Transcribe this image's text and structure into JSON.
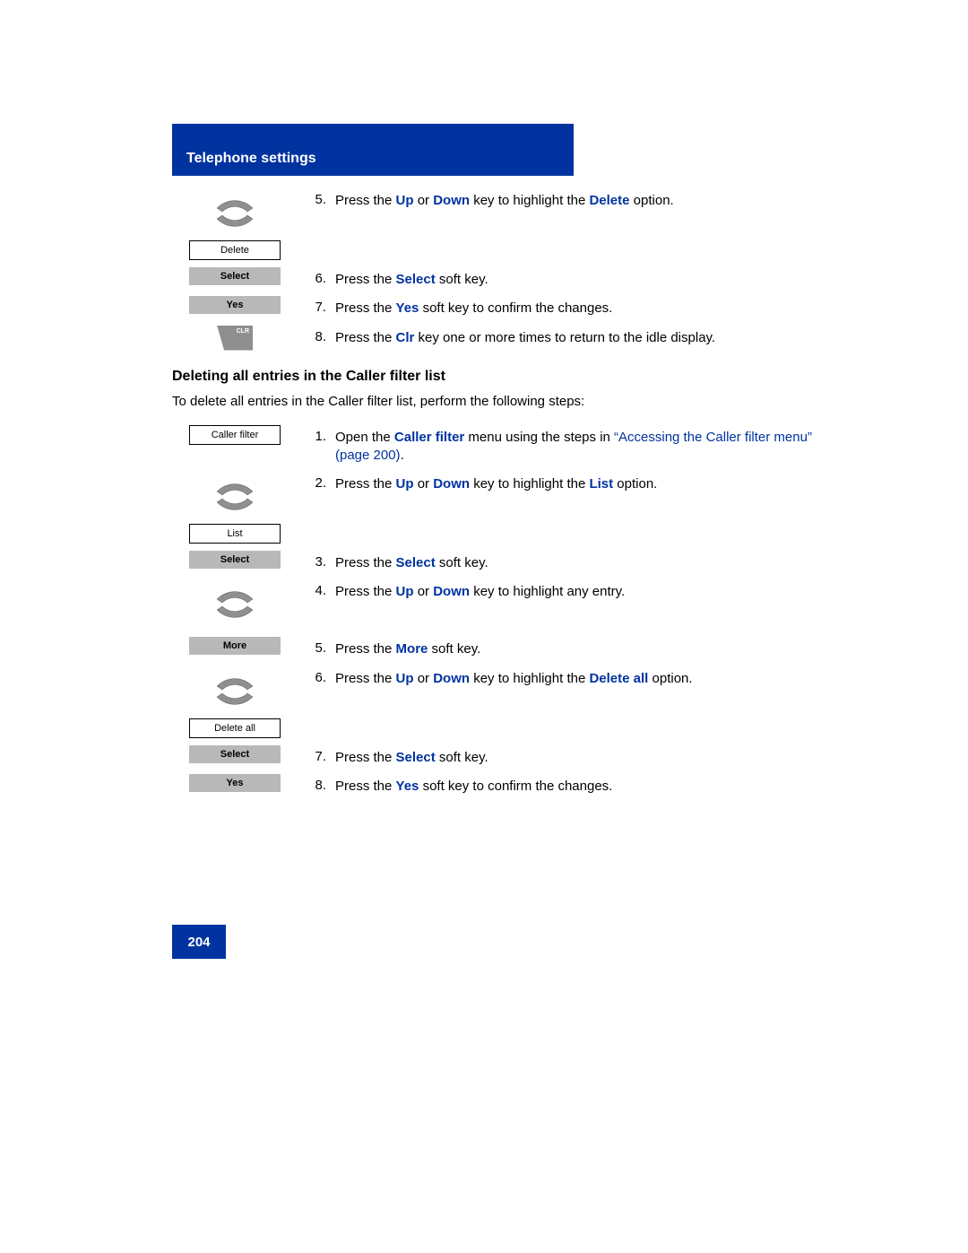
{
  "header": {
    "title": "Telephone settings"
  },
  "section1": {
    "steps": [
      {
        "no": "5.",
        "icon": "updown",
        "menu": "Delete",
        "parts": [
          {
            "t": "Press the "
          },
          {
            "t": "Up",
            "b": true
          },
          {
            "t": " or "
          },
          {
            "t": "Down",
            "b": true
          },
          {
            "t": " key to highlight the "
          },
          {
            "t": "Delete",
            "b": true
          },
          {
            "t": " option."
          }
        ]
      },
      {
        "no": "6.",
        "icon": "softkey",
        "soft": "Select",
        "parts": [
          {
            "t": "Press the "
          },
          {
            "t": "Select",
            "b": true
          },
          {
            "t": " soft key."
          }
        ]
      },
      {
        "no": "7.",
        "icon": "softkey",
        "soft": "Yes",
        "parts": [
          {
            "t": "Press the "
          },
          {
            "t": "Yes",
            "b": true
          },
          {
            "t": " soft key to confirm the changes."
          }
        ]
      },
      {
        "no": "8.",
        "icon": "clr",
        "parts": [
          {
            "t": "Press the "
          },
          {
            "t": "Clr",
            "b": true
          },
          {
            "t": " key one or more times to return to the idle display."
          }
        ]
      }
    ]
  },
  "section2": {
    "heading": "Deleting all entries in the Caller filter list",
    "intro": "To delete all entries in the Caller filter list, perform the following steps:",
    "steps": [
      {
        "no": "1.",
        "icon": "menu",
        "menu": "Caller filter",
        "parts": [
          {
            "t": "Open the "
          },
          {
            "t": "Caller filter",
            "b": true
          },
          {
            "t": " menu using the steps in "
          },
          {
            "t": "“Accessing the Caller filter menu” (page 200)",
            "link": true
          },
          {
            "t": "."
          }
        ]
      },
      {
        "no": "2.",
        "icon": "updown",
        "menu": "List",
        "parts": [
          {
            "t": "Press the "
          },
          {
            "t": "Up",
            "b": true
          },
          {
            "t": " or "
          },
          {
            "t": "Down",
            "b": true
          },
          {
            "t": " key to highlight the "
          },
          {
            "t": "List",
            "b": true
          },
          {
            "t": " option."
          }
        ]
      },
      {
        "no": "3.",
        "icon": "softkey",
        "soft": "Select",
        "parts": [
          {
            "t": "Press the "
          },
          {
            "t": "Select",
            "b": true
          },
          {
            "t": " soft key."
          }
        ]
      },
      {
        "no": "4.",
        "icon": "updown",
        "parts": [
          {
            "t": "Press the "
          },
          {
            "t": "Up",
            "b": true
          },
          {
            "t": " or "
          },
          {
            "t": "Down",
            "b": true
          },
          {
            "t": " key to highlight any entry."
          }
        ]
      },
      {
        "no": "5.",
        "icon": "softkey",
        "soft": "More",
        "parts": [
          {
            "t": "Press the "
          },
          {
            "t": "More",
            "b": true
          },
          {
            "t": " soft key."
          }
        ]
      },
      {
        "no": "6.",
        "icon": "updown",
        "menu": "Delete all",
        "parts": [
          {
            "t": "Press the "
          },
          {
            "t": "Up",
            "b": true
          },
          {
            "t": " or "
          },
          {
            "t": "Down",
            "b": true
          },
          {
            "t": " key to highlight the "
          },
          {
            "t": "Delete all",
            "b": true
          },
          {
            "t": " option."
          }
        ]
      },
      {
        "no": "7.",
        "icon": "softkey",
        "soft": "Select",
        "parts": [
          {
            "t": "Press the "
          },
          {
            "t": "Select",
            "b": true
          },
          {
            "t": " soft key."
          }
        ]
      },
      {
        "no": "8.",
        "icon": "softkey",
        "soft": "Yes",
        "parts": [
          {
            "t": "Press the "
          },
          {
            "t": "Yes",
            "b": true
          },
          {
            "t": " soft key to confirm the changes."
          }
        ]
      }
    ]
  },
  "footer": {
    "page": "204"
  },
  "clr_label": "CLR"
}
